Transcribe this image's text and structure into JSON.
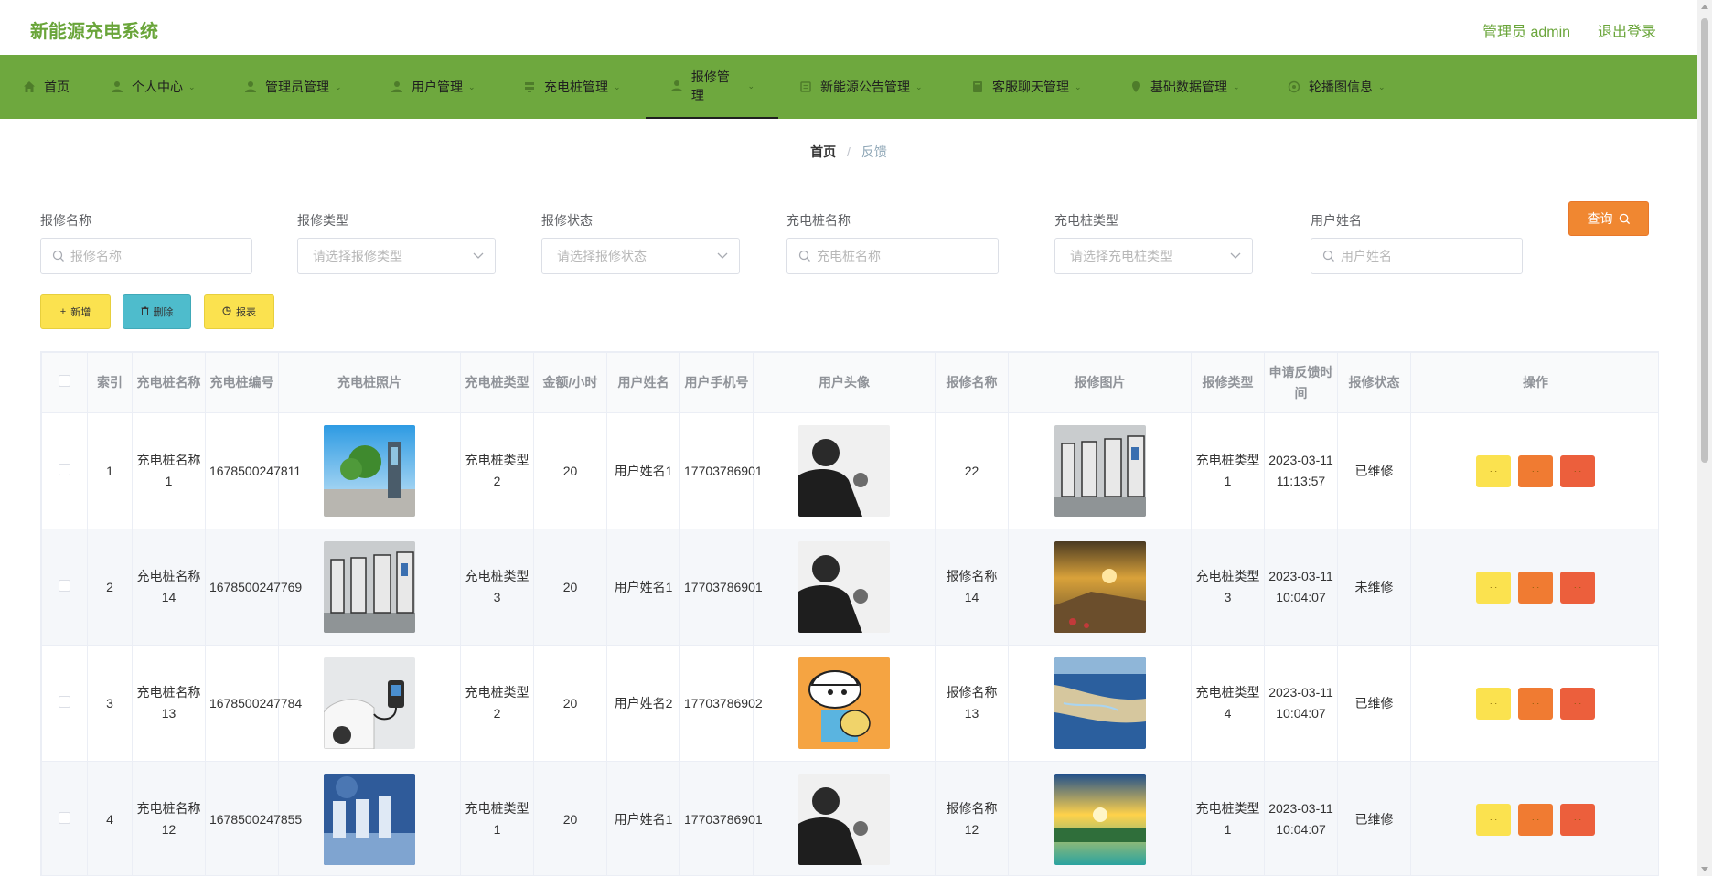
{
  "app": {
    "title": "新能源充电系统",
    "admin_label": "管理员 admin",
    "logout_label": "退出登录"
  },
  "nav": [
    {
      "label": "首页",
      "icon": "home-icon"
    },
    {
      "label": "个人中心",
      "icon": "user-icon"
    },
    {
      "label": "管理员管理",
      "icon": "user-icon"
    },
    {
      "label": "用户管理",
      "icon": "user-icon"
    },
    {
      "label": "充电桩管理",
      "icon": "charger-icon"
    },
    {
      "label": "报修管理",
      "icon": "user-icon",
      "active": true
    },
    {
      "label": "新能源公告管理",
      "icon": "notice-icon"
    },
    {
      "label": "客服聊天管理",
      "icon": "chat-icon"
    },
    {
      "label": "基础数据管理",
      "icon": "data-icon"
    },
    {
      "label": "轮播图信息",
      "icon": "carousel-icon"
    }
  ],
  "breadcrumb": {
    "home": "首页",
    "separator": "/",
    "current": "反馈"
  },
  "filters": {
    "repair_name": {
      "label": "报修名称",
      "placeholder": "报修名称"
    },
    "repair_type": {
      "label": "报修类型",
      "placeholder": "请选择报修类型"
    },
    "repair_status": {
      "label": "报修状态",
      "placeholder": "请选择报修状态"
    },
    "pile_name": {
      "label": "充电桩名称",
      "placeholder": "充电桩名称"
    },
    "pile_type": {
      "label": "充电桩类型",
      "placeholder": "请选择充电桩类型"
    },
    "user_name": {
      "label": "用户姓名",
      "placeholder": "用户姓名"
    }
  },
  "buttons": {
    "query": "查询",
    "add": "新增",
    "delete": "删除",
    "report": "报表"
  },
  "table": {
    "headers": [
      "",
      "索引",
      "充电桩名称",
      "充电桩编号",
      "充电桩照片",
      "充电桩类型",
      "金额/小时",
      "用户姓名",
      "用户手机号",
      "用户头像",
      "报修名称",
      "报修图片",
      "报修类型",
      "申请反馈时间",
      "报修状态",
      "操作"
    ],
    "rows": [
      {
        "index": "1",
        "pile_name": "充电桩名称1",
        "pile_no": "1678500247811",
        "pile_type": "充电桩类型2",
        "price": "20",
        "user_name": "用户姓名1",
        "phone": "17703786901",
        "repair_name": "22",
        "repair_type": "充电桩类型1",
        "time": "2023-03-11 11:13:57",
        "status": "已维修"
      },
      {
        "index": "2",
        "pile_name": "充电桩名称14",
        "pile_no": "1678500247769",
        "pile_type": "充电桩类型3",
        "price": "20",
        "user_name": "用户姓名1",
        "phone": "17703786901",
        "repair_name": "报修名称14",
        "repair_type": "充电桩类型3",
        "time": "2023-03-11 10:04:07",
        "status": "未维修"
      },
      {
        "index": "3",
        "pile_name": "充电桩名称13",
        "pile_no": "1678500247784",
        "pile_type": "充电桩类型2",
        "price": "20",
        "user_name": "用户姓名2",
        "phone": "17703786902",
        "repair_name": "报修名称13",
        "repair_type": "充电桩类型4",
        "time": "2023-03-11 10:04:07",
        "status": "已维修"
      },
      {
        "index": "4",
        "pile_name": "充电桩名称12",
        "pile_no": "1678500247855",
        "pile_type": "充电桩类型1",
        "price": "20",
        "user_name": "用户姓名1",
        "phone": "17703786901",
        "repair_name": "报修名称12",
        "repair_type": "充电桩类型1",
        "time": "2023-03-11 10:04:07",
        "status": "已维修"
      }
    ]
  },
  "colors": {
    "brand": "#6aa53a",
    "nav_bg": "#6ea83e",
    "query": "#f08731",
    "yellow": "#fbe24f",
    "teal": "#4ebccc",
    "orange": "#f07b32",
    "red": "#ec5f3c"
  }
}
